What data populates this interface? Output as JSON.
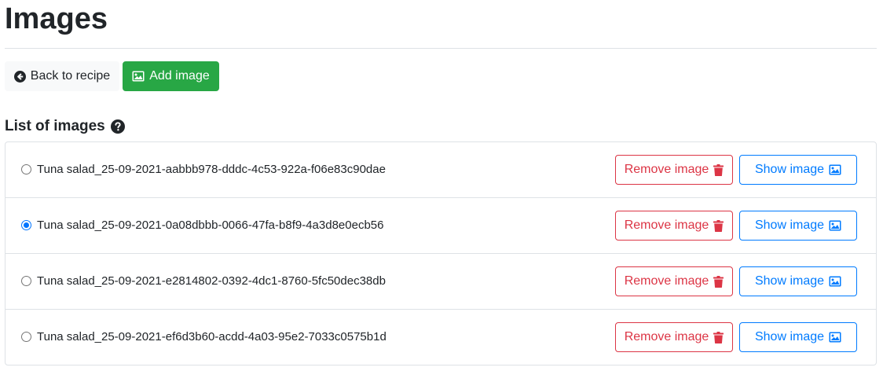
{
  "page": {
    "title": "Images"
  },
  "toolbar": {
    "back_label": "Back to recipe",
    "add_label": "Add image"
  },
  "list": {
    "title": "List of images",
    "remove_label": "Remove image",
    "show_label": "Show image",
    "items": [
      {
        "label": "Tuna salad_25-09-2021-aabbb978-dddc-4c53-922a-f06e83c90dae",
        "selected": false
      },
      {
        "label": "Tuna salad_25-09-2021-0a08dbbb-0066-47fa-b8f9-4a3d8e0ecb56",
        "selected": true
      },
      {
        "label": "Tuna salad_25-09-2021-e2814802-0392-4dc1-8760-5fc50dec38db",
        "selected": false
      },
      {
        "label": "Tuna salad_25-09-2021-ef6d3b60-acdd-4a03-95e2-7033c0575b1d",
        "selected": false
      }
    ]
  },
  "colors": {
    "success": "#28a745",
    "danger": "#dc3545",
    "primary": "#007bff",
    "light": "#f8f9fa"
  },
  "icons": {
    "back": "arrow-circle-left-icon",
    "add": "image-icon",
    "help": "question-circle-icon",
    "remove": "trash-icon",
    "show": "image-icon"
  }
}
